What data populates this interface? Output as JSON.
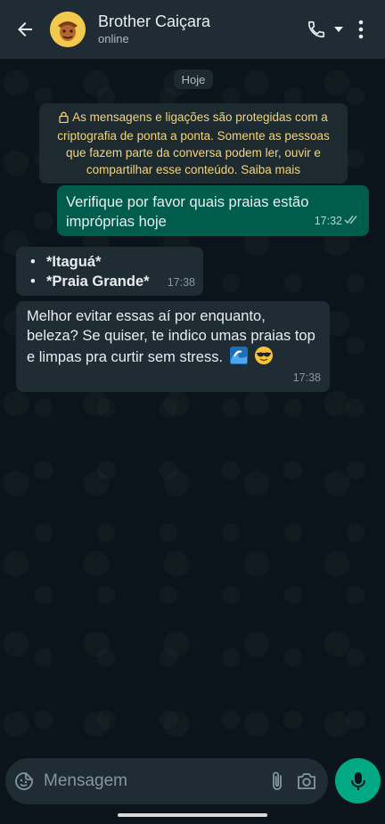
{
  "header": {
    "contact_name": "Brother Caiçara",
    "status": "online",
    "icons": [
      "back-arrow-icon",
      "avatar",
      "phone-icon",
      "dropdown-caret-icon",
      "more-vert-icon"
    ]
  },
  "chat": {
    "date_label": "Hoje",
    "e2e_notice": "As mensagens e ligações são protegidas com a criptografia de ponta a ponta. Somente as pessoas que fazem parte da conversa podem ler, ouvir e compartilhar esse conteúdo. Saiba mais",
    "messages": [
      {
        "direction": "outgoing",
        "text": "Verifique por favor quais praias estão impróprias hoje",
        "time": "17:32",
        "status": "read"
      },
      {
        "direction": "incoming",
        "items": [
          "*Itaguá*",
          "*Praia Grande*"
        ],
        "time": "17:38"
      },
      {
        "direction": "incoming",
        "text": "Melhor evitar essas aí por enquanto, beleza? Se quiser, te indico umas praias top e limpas pra curtir sem stress.",
        "emojis": [
          "wave-emoji",
          "sunglasses-emoji"
        ],
        "time": "17:38"
      }
    ]
  },
  "input": {
    "placeholder": "Mensagem",
    "value": ""
  },
  "colors": {
    "header_bg": "#1f2c34",
    "chat_bg": "#0b141a",
    "outgoing_bubble": "#005c4b",
    "incoming_bubble": "#1f2c34",
    "accent": "#00a884",
    "e2e_text": "#f4d47c"
  }
}
